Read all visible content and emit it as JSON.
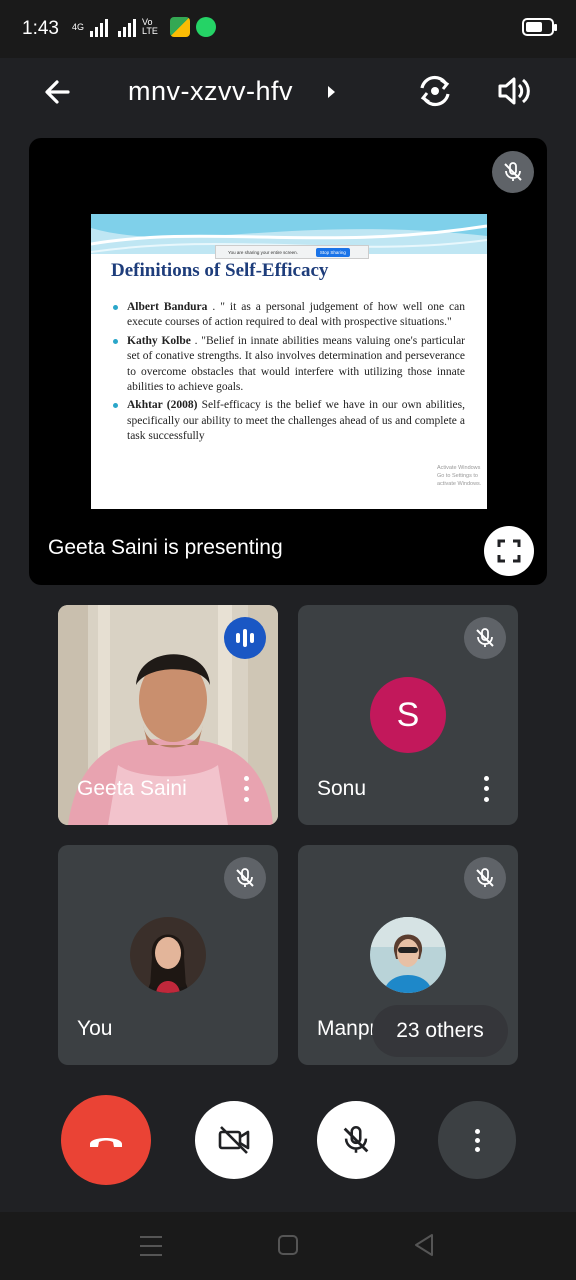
{
  "status_bar": {
    "time": "1:43",
    "network_label_1": "4G",
    "network_label_2": "Vo LTE"
  },
  "header": {
    "meeting_code": "mnv-xzvv-hfv"
  },
  "presentation": {
    "slide": {
      "share_banner_text": "You are sharing your entire screen.",
      "share_banner_button": "Stop Sharing",
      "title": "Definitions of Self-Efficacy",
      "bullets": [
        {
          "name": "Albert Bandura",
          "text": " . \" it as a personal judgement of how well one can execute courses of action required to deal with prospective situations.\""
        },
        {
          "name": "Kathy Kolbe",
          "text": " . \"Belief in innate abilities means valuing one's particular set of conative strengths. It also involves determination and perseverance to overcome obstacles that would interfere with utilizing those innate abilities to achieve goals."
        },
        {
          "name": "Akhtar (2008)",
          "text": " Self-efficacy is the belief we have in our own abilities, specifically our ability to meet the challenges ahead of us and complete a task successfully"
        }
      ],
      "watermark_line1": "Activate Windows",
      "watermark_line2": "Go to Settings to activate Windows."
    },
    "presenting_label": "Geeta Saini is presenting"
  },
  "participants": [
    {
      "name": "Geeta Saini",
      "state": "speaking"
    },
    {
      "name": "Sonu",
      "initial": "S",
      "avatar_color": "#c2185b",
      "state": "muted"
    },
    {
      "name": "You",
      "state": "muted"
    },
    {
      "name": "Manpreet",
      "state": "muted"
    }
  ],
  "others_chip": "23 others",
  "colors": {
    "end_call": "#ea4335",
    "speaking": "#1a57c4",
    "background": "#202124"
  }
}
